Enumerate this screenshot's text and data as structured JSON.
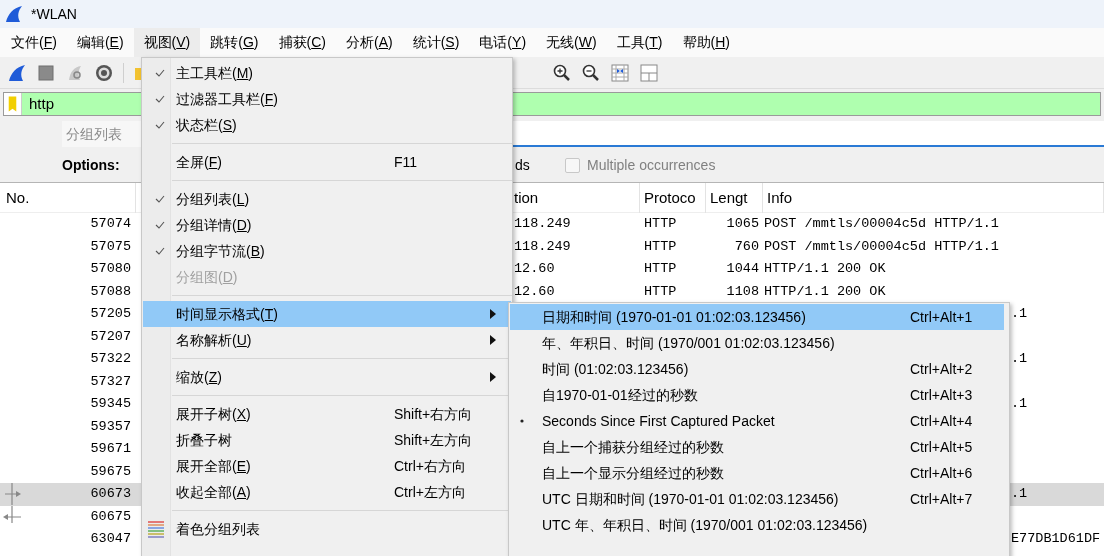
{
  "window": {
    "title": "*WLAN"
  },
  "menu_bar": [
    {
      "label": "文件(F)",
      "selected": false
    },
    {
      "label": "编辑(E)",
      "selected": false
    },
    {
      "label": "视图(V)",
      "selected": true
    },
    {
      "label": "跳转(G)",
      "selected": false
    },
    {
      "label": "捕获(C)",
      "selected": false
    },
    {
      "label": "分析(A)",
      "selected": false
    },
    {
      "label": "统计(S)",
      "selected": false
    },
    {
      "label": "电话(Y)",
      "selected": false
    },
    {
      "label": "无线(W)",
      "selected": false
    },
    {
      "label": "工具(T)",
      "selected": false
    },
    {
      "label": "帮助(H)",
      "selected": false
    }
  ],
  "display_filter": {
    "value": "http",
    "valid": true
  },
  "search_bar": {
    "scope": "分组列表"
  },
  "search_options": {
    "label": "Options:",
    "field_tail": "ds",
    "multiple_occurrences": {
      "label": "Multiple occurrences",
      "checked": false,
      "disabled": true
    }
  },
  "packet_list": {
    "columns": [
      {
        "label": "No."
      },
      {
        "label": "tion"
      },
      {
        "label": "Protoco"
      },
      {
        "label": "Lengt"
      },
      {
        "label": "Info"
      }
    ],
    "rows": [
      {
        "no": "57074",
        "destination": "118.249",
        "protocol": "HTTP",
        "length": "1065",
        "info": "POST /mmtls/00004c5d HTTP/1.1",
        "selected": false
      },
      {
        "no": "57075",
        "destination": "118.249",
        "protocol": "HTTP",
        "length": "760",
        "info": "POST /mmtls/00004c5d HTTP/1.1",
        "selected": false
      },
      {
        "no": "57080",
        "destination": "12.60",
        "protocol": "HTTP",
        "length": "1044",
        "info": "HTTP/1.1 200 OK",
        "selected": false
      },
      {
        "no": "57088",
        "destination": "12.60",
        "protocol": "HTTP",
        "length": "1108",
        "info": "HTTP/1.1 200 OK",
        "selected": false
      },
      {
        "no": "57205",
        "info_tail": ".1",
        "selected": false
      },
      {
        "no": "57207",
        "selected": false
      },
      {
        "no": "57322",
        "info_tail": ".1",
        "selected": false
      },
      {
        "no": "57327",
        "selected": false
      },
      {
        "no": "59345",
        "info_tail": ".1",
        "selected": false
      },
      {
        "no": "59357",
        "selected": false
      },
      {
        "no": "59671",
        "selected": false
      },
      {
        "no": "59675",
        "selected": false
      },
      {
        "no": "60673",
        "info_tail": ".1",
        "selected": true,
        "kind": "request"
      },
      {
        "no": "60675",
        "selected": false,
        "kind": "response"
      },
      {
        "no": "63047",
        "info_tail": "E77DB1D61DF",
        "selected": false
      }
    ]
  },
  "view_menu": {
    "items": [
      {
        "kind": "check",
        "label": "主工具栏(M)",
        "checked": true,
        "selected": false
      },
      {
        "kind": "check",
        "label": "过滤器工具栏(F)",
        "checked": true,
        "selected": false
      },
      {
        "kind": "check",
        "label": "状态栏(S)",
        "checked": true,
        "selected": false
      },
      {
        "kind": "separator"
      },
      {
        "kind": "action",
        "label": "全屏(F)",
        "shortcut": "F11",
        "selected": false
      },
      {
        "kind": "separator"
      },
      {
        "kind": "check",
        "label": "分组列表(L)",
        "checked": true,
        "selected": false
      },
      {
        "kind": "check",
        "label": "分组详情(D)",
        "checked": true,
        "selected": false
      },
      {
        "kind": "check",
        "label": "分组字节流(B)",
        "checked": true,
        "selected": false
      },
      {
        "kind": "check",
        "label": "分组图(D)",
        "checked": false,
        "disabled": true,
        "selected": false
      },
      {
        "kind": "separator"
      },
      {
        "kind": "submenu",
        "label": "时间显示格式(T)",
        "selected": true
      },
      {
        "kind": "submenu",
        "label": "名称解析(U)",
        "selected": false
      },
      {
        "kind": "separator"
      },
      {
        "kind": "submenu",
        "label": "缩放(Z)",
        "selected": false
      },
      {
        "kind": "separator"
      },
      {
        "kind": "action",
        "label": "展开子树(X)",
        "shortcut": "Shift+右方向",
        "selected": false
      },
      {
        "kind": "action",
        "label": "折叠子树",
        "shortcut": "Shift+左方向",
        "selected": false
      },
      {
        "kind": "action",
        "label": "展开全部(E)",
        "shortcut": "Ctrl+右方向",
        "selected": false
      },
      {
        "kind": "action",
        "label": "收起全部(A)",
        "shortcut": "Ctrl+左方向",
        "selected": false
      },
      {
        "kind": "separator"
      },
      {
        "kind": "colorize",
        "label": "着色分组列表",
        "selected": false
      }
    ]
  },
  "time_format_menu": {
    "items": [
      {
        "label": "日期和时间 (1970-01-01 01:02:03.123456)",
        "shortcut": "Ctrl+Alt+1",
        "checked": false,
        "selected": true
      },
      {
        "label": "年、年积日、时间 (1970/001 01:02:03.123456)",
        "checked": false,
        "selected": false
      },
      {
        "label": "时间 (01:02:03.123456)",
        "shortcut": "Ctrl+Alt+2",
        "checked": false,
        "selected": false
      },
      {
        "label": "自1970-01-01经过的秒数",
        "shortcut": "Ctrl+Alt+3",
        "checked": false,
        "selected": false
      },
      {
        "label": "Seconds Since First Captured Packet",
        "shortcut": "Ctrl+Alt+4",
        "checked": true,
        "selected": false
      },
      {
        "label": "自上一个捕获分组经过的秒数",
        "shortcut": "Ctrl+Alt+5",
        "checked": false,
        "selected": false
      },
      {
        "label": "自上一个显示分组经过的秒数",
        "shortcut": "Ctrl+Alt+6",
        "checked": false,
        "selected": false
      },
      {
        "label": "UTC 日期和时间 (1970-01-01 01:02:03.123456)",
        "shortcut": "Ctrl+Alt+7",
        "checked": false,
        "selected": false
      },
      {
        "label": "UTC 年、年积日、时间 (1970/001 01:02:03.123456)",
        "checked": false,
        "selected": false
      }
    ]
  }
}
